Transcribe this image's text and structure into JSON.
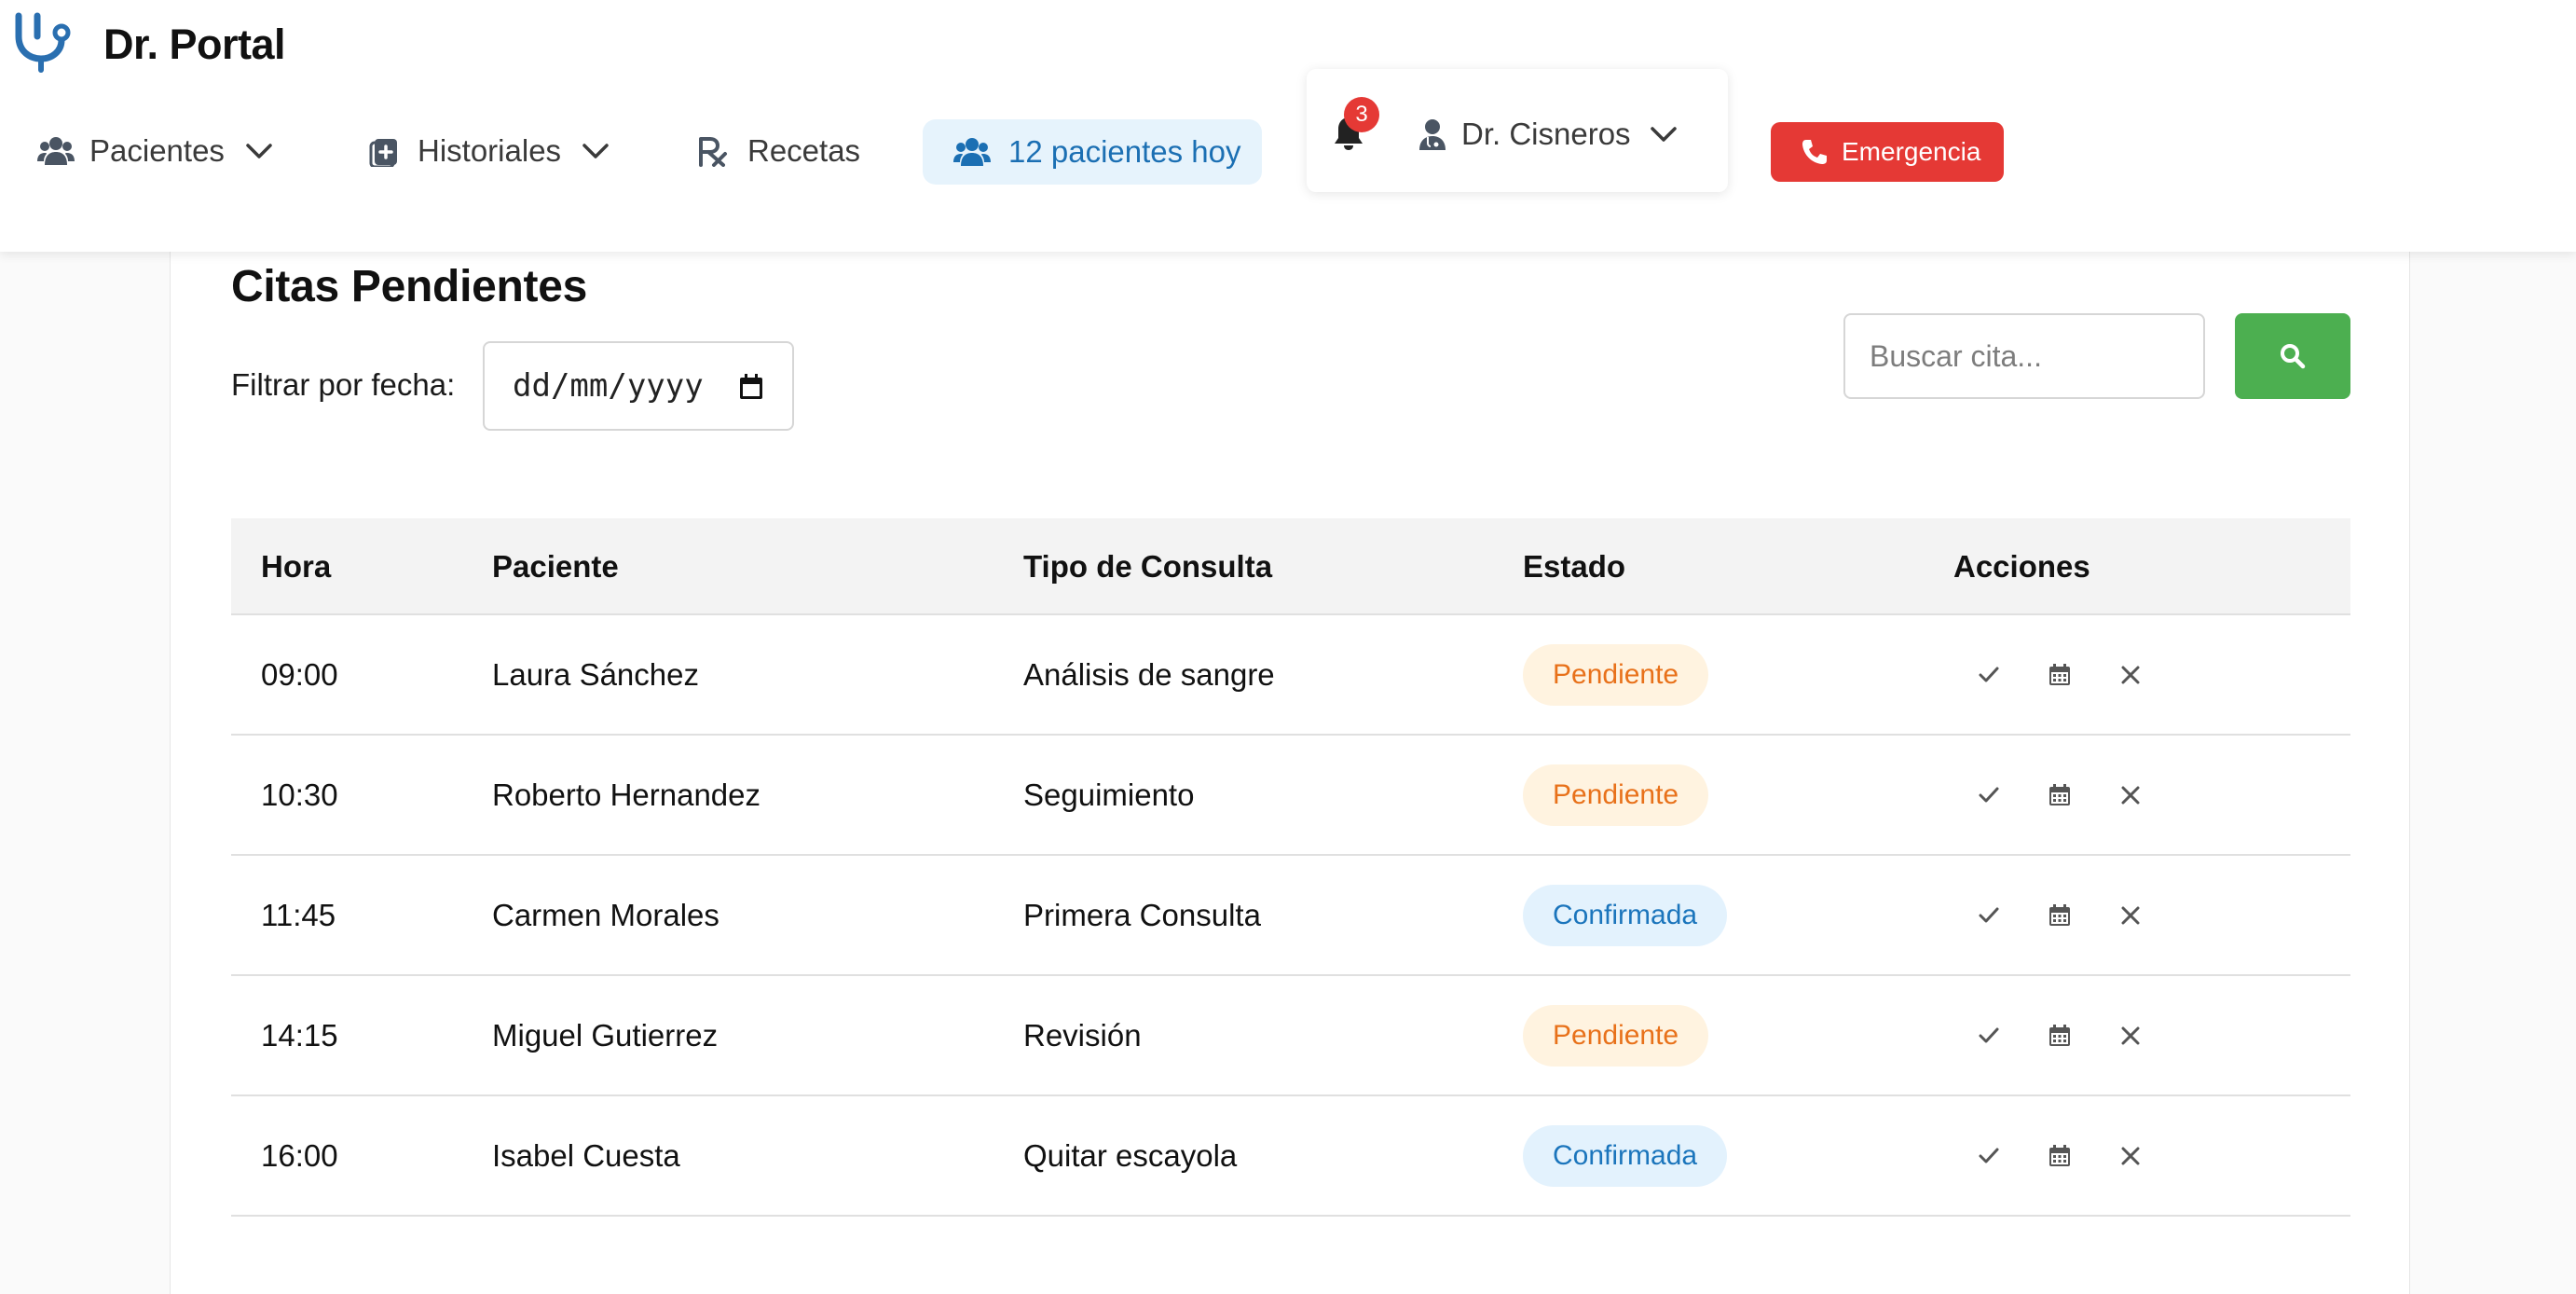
{
  "app": {
    "name": "Dr. Portal"
  },
  "nav": {
    "pacientes": "Pacientes",
    "historiales": "Historiales",
    "recetas": "Recetas",
    "today": "12 pacientes hoy"
  },
  "user": {
    "notifications": "3",
    "name": "Dr. Cisneros"
  },
  "emergency": {
    "label": "Emergencia"
  },
  "page": {
    "title": "Citas Pendientes",
    "filter_label": "Filtrar por fecha:",
    "date_placeholder": "dd/mm/yyyy",
    "search_placeholder": "Buscar cita..."
  },
  "table": {
    "headers": [
      "Hora",
      "Paciente",
      "Tipo de Consulta",
      "Estado",
      "Acciones"
    ],
    "rows": [
      {
        "hora": "09:00",
        "paciente": "Laura Sánchez",
        "tipo": "Análisis de sangre",
        "estado": "Pendiente"
      },
      {
        "hora": "10:30",
        "paciente": "Roberto Hernandez",
        "tipo": "Seguimiento",
        "estado": "Pendiente"
      },
      {
        "hora": "11:45",
        "paciente": "Carmen Morales",
        "tipo": "Primera Consulta",
        "estado": "Confirmada"
      },
      {
        "hora": "14:15",
        "paciente": "Miguel Gutierrez",
        "tipo": "Revisión",
        "estado": "Pendiente"
      },
      {
        "hora": "16:00",
        "paciente": "Isabel Cuesta",
        "tipo": "Quitar escayola",
        "estado": "Confirmada"
      }
    ]
  },
  "colors": {
    "brand_blue": "#2a6fb0",
    "emergency_red": "#e53935",
    "search_green": "#4caf50",
    "pending_bg": "#fff3e0",
    "pending_text": "#e8711a",
    "confirmed_bg": "#e3f2fd",
    "confirmed_text": "#1b75bc"
  },
  "icons": {
    "logo": "stethoscope-icon",
    "pacientes": "users-icon",
    "historiales": "file-medical-icon",
    "recetas": "prescription-icon",
    "today": "users-icon",
    "notifications": "bell-icon",
    "user": "user-doctor-icon",
    "emergency": "phone-icon",
    "search": "search-icon",
    "row_actions": [
      "check-icon",
      "calendar-icon",
      "close-icon"
    ]
  }
}
